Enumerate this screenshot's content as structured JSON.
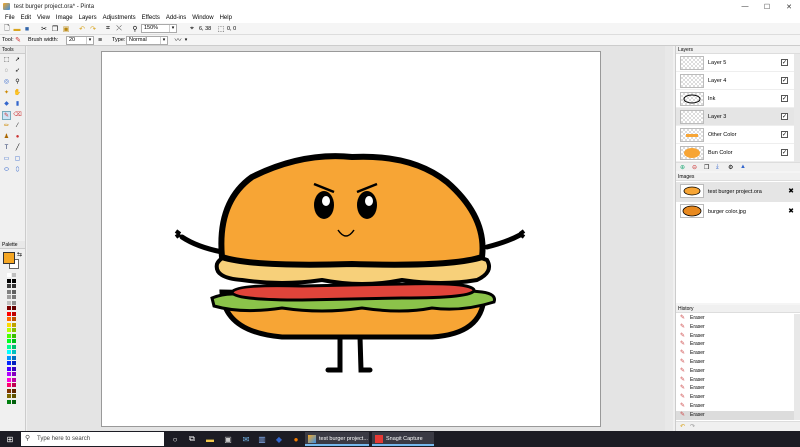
{
  "window": {
    "title": "test burger project.ora* - Pinta",
    "controls": [
      "—",
      "☐",
      "✕"
    ]
  },
  "menu": [
    "File",
    "Edit",
    "View",
    "Image",
    "Layers",
    "Adjustments",
    "Effects",
    "Add-ins",
    "Window",
    "Help"
  ],
  "toolbar": {
    "zoom_value": "150%",
    "cursor_pos": "6, 38",
    "selection_size": "0, 0"
  },
  "tool_options": {
    "tool_label": "Tool:",
    "brush_width_label": "Brush width:",
    "brush_width_value": "20",
    "type_label": "Type:",
    "type_value": "Normal"
  },
  "panels": {
    "tools_title": "Tools",
    "palette_title": "Palette",
    "layers_title": "Layers",
    "images_title": "Images",
    "history_title": "History"
  },
  "layers": [
    {
      "name": "Layer 5",
      "visible": true
    },
    {
      "name": "Layer 4",
      "visible": true
    },
    {
      "name": "Ink",
      "visible": true
    },
    {
      "name": "Layer 3",
      "visible": true
    },
    {
      "name": "Other Color",
      "visible": true
    },
    {
      "name": "Bun Color",
      "visible": true
    }
  ],
  "images": [
    {
      "name": "test burger project.ora"
    },
    {
      "name": "burger color.jpg"
    }
  ],
  "history": [
    "Eraser",
    "Eraser",
    "Eraser",
    "Eraser",
    "Eraser",
    "Eraser",
    "Eraser",
    "Eraser",
    "Eraser",
    "Eraser",
    "Eraser",
    "Eraser"
  ],
  "palette": {
    "primary_color": "#f5a623",
    "secondary_color": "#ffffff"
  },
  "taskbar": {
    "search_placeholder": "Type here to search",
    "apps": [
      {
        "label": "test burger project..."
      },
      {
        "label": "Snagit Capture"
      }
    ]
  },
  "colors": {
    "bun": "#f7a535",
    "cheese": "#f7d07a",
    "lettuce": "#8bc34a",
    "tomato": "#e0443a",
    "outline": "#000000"
  }
}
